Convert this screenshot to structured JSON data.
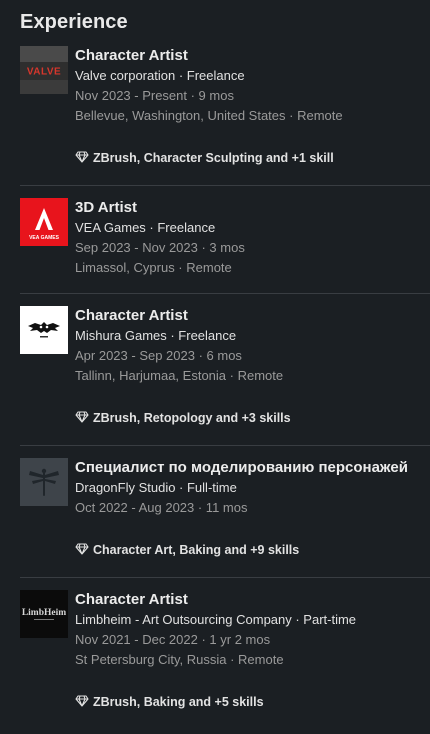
{
  "section": {
    "title": "Experience"
  },
  "entries": [
    {
      "logo_text": "VALVE",
      "role": "Character Artist",
      "company": "Valve corporation · Freelance",
      "dates": "Nov 2023 - Present · 9 mos",
      "location": "Bellevue, Washington, United States · Remote",
      "skills": "ZBrush, Character Sculpting and +1 skill"
    },
    {
      "logo_text": "VEA GAMES",
      "role": "3D Artist",
      "company": "VEA Games · Freelance",
      "dates": "Sep 2023 - Nov 2023 · 3 mos",
      "location": "Limassol, Cyprus · Remote"
    },
    {
      "role": "Character Artist",
      "company": "Mishura Games · Freelance",
      "dates": "Apr 2023 - Sep 2023 · 6 mos",
      "location": "Tallinn, Harjumaa, Estonia · Remote",
      "skills": "ZBrush, Retopology and +3 skills"
    },
    {
      "role": "Специалист по моделированию персонажей",
      "company": "DragonFly Studio · Full-time",
      "dates": "Oct 2022 - Aug 2023 · 11 mos",
      "skills": "Character Art, Baking and +9 skills"
    },
    {
      "logo_text": "LimbHeim",
      "role": "Character Artist",
      "company": "Limbheim - Art Outsourcing Company · Part-time",
      "dates": "Nov 2021 - Dec 2022 · 1 yr 2 mos",
      "location": "St Petersburg City, Russia · Remote",
      "skills": "ZBrush, Baking and +5 skills"
    }
  ]
}
